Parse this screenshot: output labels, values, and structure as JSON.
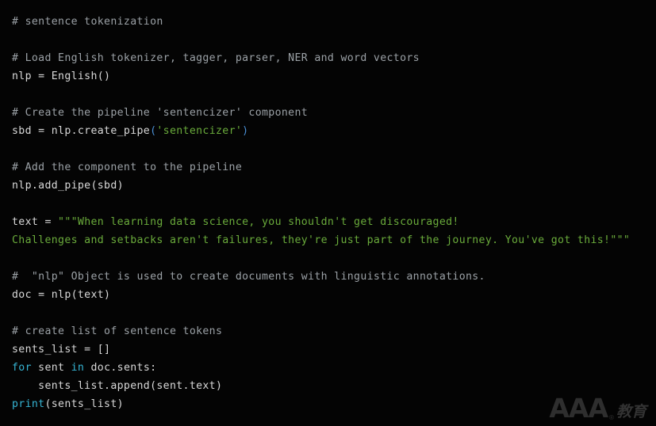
{
  "editor": {
    "background_color": "#040404",
    "default_text_color": "#d9d9d9",
    "comment_color": "#9ba1a6",
    "string_color": "#6aab3b",
    "keyword_color": "#36b5d4",
    "punctuation_color": "#4a8fd4",
    "language": "python"
  },
  "code": {
    "l01_comment": "# sentence tokenization",
    "l02_blank": " ",
    "l03_comment": "# Load English tokenizer, tagger, parser, NER and word vectors",
    "l04_a": "nlp = English()",
    "l05_blank": " ",
    "l06_comment": "# Create the pipeline 'sentencizer' component",
    "l07_a": "sbd = nlp.create_pipe",
    "l07_b": "(",
    "l07_c": "'sentencizer'",
    "l07_d": ")",
    "l08_blank": " ",
    "l09_comment": "# Add the component to the pipeline",
    "l10_a": "nlp.add_pipe(sbd)",
    "l11_blank": " ",
    "l12_a": "text = ",
    "l12_b": "\"\"\"When learning data science, you shouldn't get discouraged!",
    "l13_b": "Challenges and setbacks aren't failures, they're just part of the journey. You've got this!\"\"\"",
    "l14_blank": " ",
    "l15_comment": "#  \"nlp\" Object is used to create documents with linguistic annotations.",
    "l16_a": "doc = nlp(text)",
    "l17_blank": " ",
    "l18_comment": "# create list of sentence tokens",
    "l19_a": "sents_list = []",
    "l20_a": "for",
    "l20_b": " sent ",
    "l20_c": "in",
    "l20_d": " doc.sents:",
    "l21_a": "    sents_list.append(sent.text)",
    "l22_a": "print",
    "l22_b": "(sents_list)"
  },
  "watermark": {
    "brand": "AAA",
    "registered": "®",
    "subtitle": "教育"
  }
}
